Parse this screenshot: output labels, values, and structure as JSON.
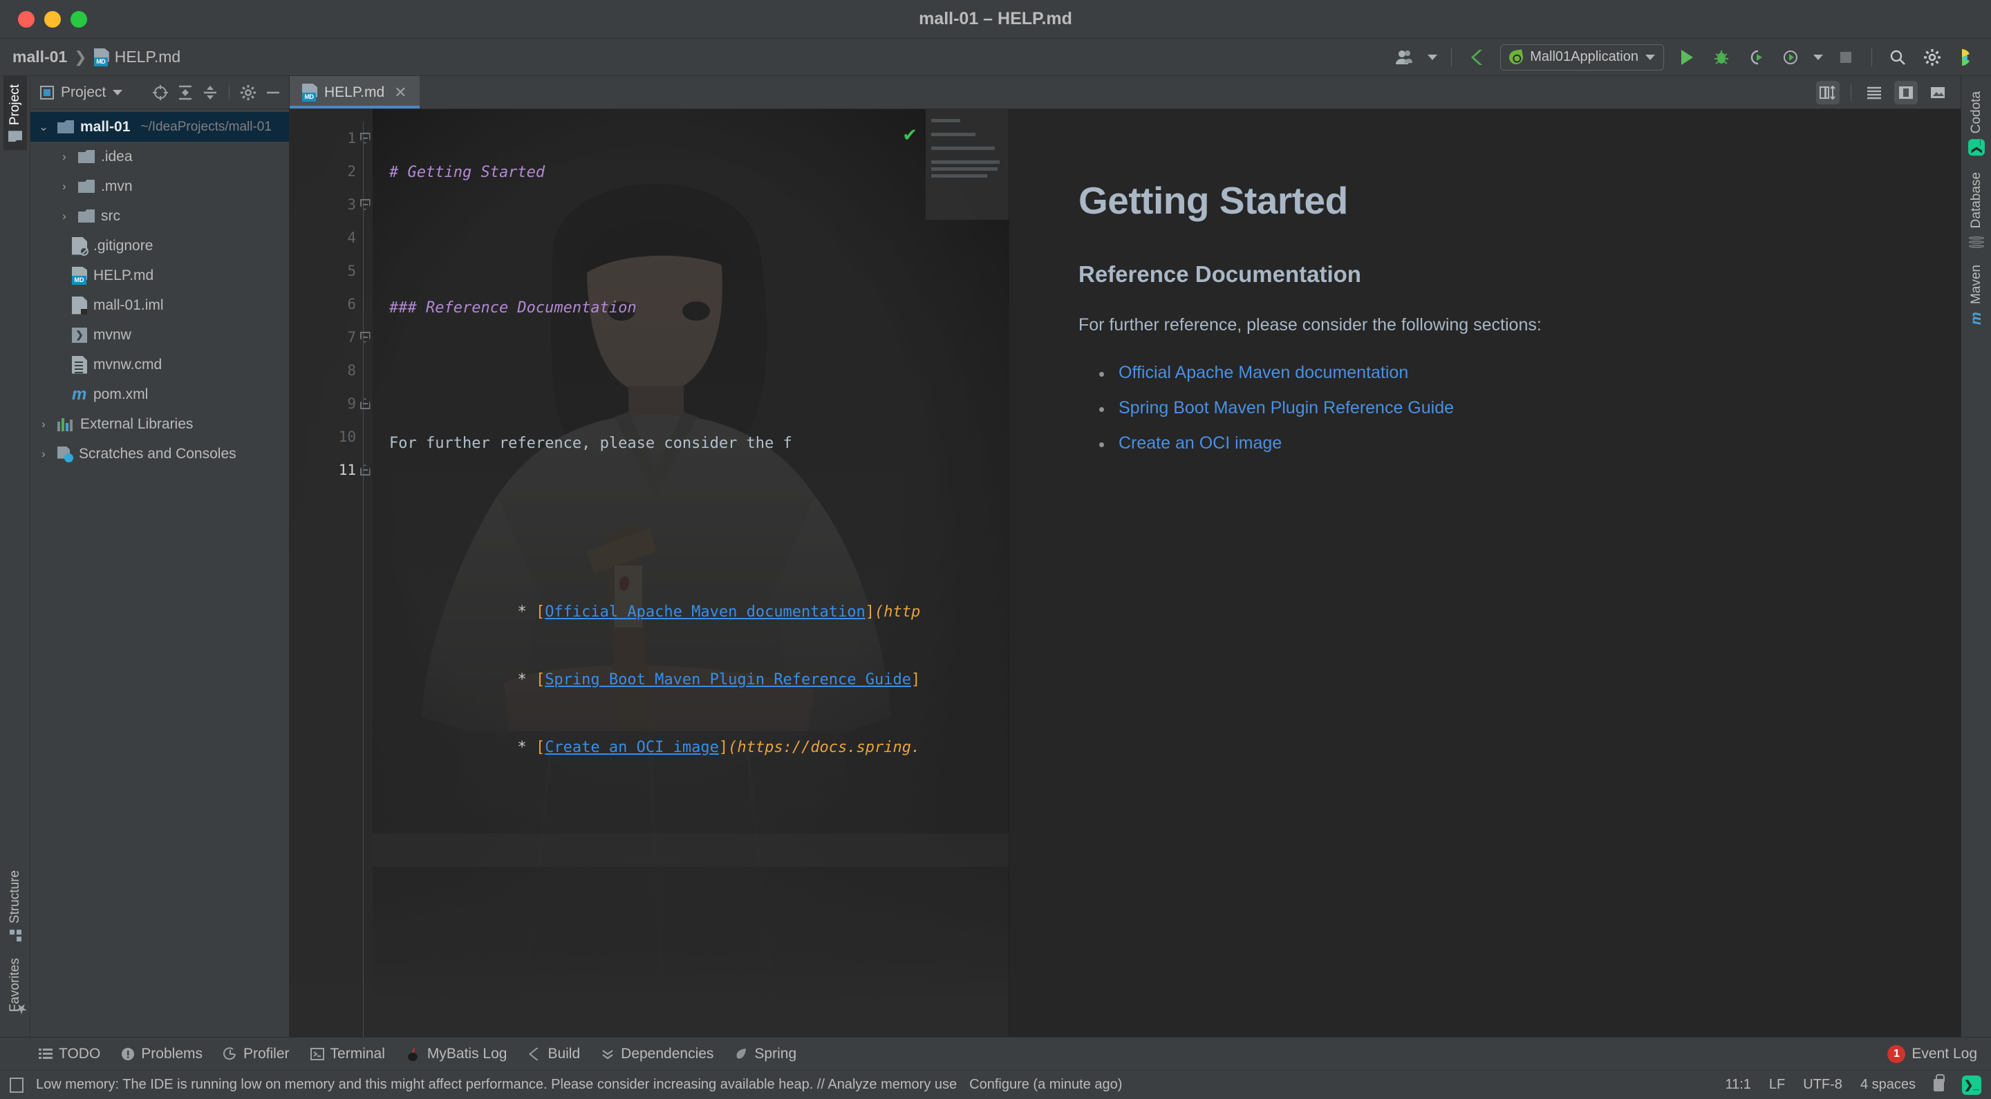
{
  "window": {
    "title": "mall-01 – HELP.md",
    "controls": [
      "close",
      "minimize",
      "maximize"
    ]
  },
  "navbar": {
    "breadcrumb": [
      {
        "label": "mall-01",
        "icon": ""
      },
      {
        "label": "HELP.md",
        "icon": "markdown-file-icon"
      }
    ],
    "separator": "❯",
    "run_config": {
      "label": "Mall01Application",
      "icon": "spring-leaf-icon",
      "caret": "▾"
    },
    "icons": [
      {
        "name": "user-accounts-icon",
        "glyph": "👥"
      },
      {
        "name": "vcs-update-icon",
        "glyph": "✓"
      },
      {
        "name": "run-icon",
        "glyph": "▶"
      },
      {
        "name": "debug-icon",
        "glyph": "🐞"
      },
      {
        "name": "run-with-coverage-icon",
        "glyph": "↻"
      },
      {
        "name": "profiler-icon",
        "glyph": "⏱"
      },
      {
        "name": "stop-icon",
        "glyph": "■"
      },
      {
        "name": "search-everywhere-icon",
        "glyph": "🔍"
      },
      {
        "name": "settings-gear-icon",
        "glyph": "⚙"
      },
      {
        "name": "ide-features-icon",
        "glyph": "◑"
      }
    ]
  },
  "left_strip": {
    "top": [
      {
        "label": "Project",
        "active": true
      }
    ],
    "bottom": [
      {
        "label": "Structure",
        "active": false
      },
      {
        "label": "Favorites",
        "active": false
      }
    ]
  },
  "project_panel": {
    "title": "Project",
    "title_caret": "▾",
    "tools": [
      {
        "name": "select-opened-file-icon",
        "glyph": "⊕"
      },
      {
        "name": "expand-all-icon",
        "glyph": "⬍"
      },
      {
        "name": "collapse-all-icon",
        "glyph": "⬌"
      },
      {
        "name": "panel-settings-icon",
        "glyph": "⚙"
      },
      {
        "name": "hide-panel-icon",
        "glyph": "—"
      }
    ],
    "tree": [
      {
        "label": "mall-01",
        "path": "~/IdeaProjects/mall-01",
        "icon": "project-folder-icon",
        "chevron": "⌄",
        "level": 0,
        "selected": true,
        "bold": true
      },
      {
        "label": ".idea",
        "icon": "folder-icon",
        "chevron": "›",
        "level": 1
      },
      {
        "label": ".mvn",
        "icon": "folder-icon",
        "chevron": "›",
        "level": 1
      },
      {
        "label": "src",
        "icon": "folder-icon",
        "chevron": "›",
        "level": 1
      },
      {
        "label": ".gitignore",
        "icon": "gitignore-file-icon",
        "level": 2
      },
      {
        "label": "HELP.md",
        "icon": "markdown-file-icon",
        "level": 2
      },
      {
        "label": "mall-01.iml",
        "icon": "iml-file-icon",
        "level": 2
      },
      {
        "label": "mvnw",
        "icon": "shell-script-icon",
        "level": 2
      },
      {
        "label": "mvnw.cmd",
        "icon": "cmd-script-icon",
        "level": 2
      },
      {
        "label": "pom.xml",
        "icon": "maven-pom-icon",
        "level": 2
      },
      {
        "label": "External Libraries",
        "icon": "external-libraries-icon",
        "chevron": "›",
        "level": 0
      },
      {
        "label": "Scratches and Consoles",
        "icon": "scratches-icon",
        "chevron": "›",
        "level": 0
      }
    ]
  },
  "editor": {
    "tab": {
      "label": "HELP.md",
      "icon": "markdown-file-icon",
      "close": "✕",
      "active": true
    },
    "preview_tools": [
      {
        "name": "split-sync-scroll-icon",
        "glyph": "↕",
        "on": true
      },
      {
        "name": "show-editor-only-icon",
        "glyph": "☰",
        "on": false
      },
      {
        "name": "show-editor-and-preview-icon",
        "glyph": "▣",
        "on": true
      },
      {
        "name": "show-preview-only-icon",
        "glyph": "🖼",
        "on": false
      }
    ],
    "inspection_status": "✔",
    "line_numbers": [
      "1",
      "2",
      "3",
      "4",
      "5",
      "6",
      "7",
      "8",
      "9",
      "10",
      "11"
    ],
    "current_line": 11,
    "lines": [
      {
        "n": 1,
        "fold": "down",
        "tokens": [
          {
            "t": "# Getting Started",
            "c": "hdr"
          }
        ]
      },
      {
        "n": 2,
        "tokens": []
      },
      {
        "n": 3,
        "fold": "down",
        "tokens": [
          {
            "t": "### Reference Documentation",
            "c": "hdr"
          }
        ]
      },
      {
        "n": 4,
        "tokens": []
      },
      {
        "n": 5,
        "tokens": [
          {
            "t": "For further reference, please consider the f",
            "c": "txt"
          }
        ]
      },
      {
        "n": 6,
        "tokens": []
      },
      {
        "n": 7,
        "fold": "down",
        "tokens": [
          {
            "t": "* ",
            "c": "bullet"
          },
          {
            "t": "[",
            "c": "lbrack"
          },
          {
            "t": "Official Apache Maven documentation",
            "c": "lnk"
          },
          {
            "t": "]",
            "c": "lbrack"
          },
          {
            "t": "(http",
            "c": "url"
          }
        ]
      },
      {
        "n": 8,
        "tokens": [
          {
            "t": "* ",
            "c": "bullet"
          },
          {
            "t": "[",
            "c": "lbrack"
          },
          {
            "t": "Spring Boot Maven Plugin Reference Guide",
            "c": "lnk"
          },
          {
            "t": "]",
            "c": "lbrack"
          }
        ]
      },
      {
        "n": 9,
        "fold": "up",
        "tokens": [
          {
            "t": "* ",
            "c": "bullet"
          },
          {
            "t": "[",
            "c": "lbrack"
          },
          {
            "t": "Create an OCI image",
            "c": "lnk"
          },
          {
            "t": "]",
            "c": "lbrack"
          },
          {
            "t": "(https://docs.spring.",
            "c": "url"
          }
        ]
      },
      {
        "n": 10,
        "tokens": []
      },
      {
        "n": 11,
        "fold": "up",
        "tokens": []
      }
    ]
  },
  "preview": {
    "h1": "Getting Started",
    "h2": "Reference Documentation",
    "paragraph": "For further reference, please consider the following sections:",
    "links": [
      "Official Apache Maven documentation",
      "Spring Boot Maven Plugin Reference Guide",
      "Create an OCI image"
    ]
  },
  "right_strip": [
    {
      "label": "Codota",
      "icon": "codota-icon"
    },
    {
      "label": "Database",
      "icon": "database-icon"
    },
    {
      "label": "Maven",
      "icon": "maven-icon"
    }
  ],
  "bottom_bar": {
    "tabs": [
      {
        "label": "TODO",
        "icon": "todo-list-icon",
        "glyph": "☰"
      },
      {
        "label": "Problems",
        "icon": "problems-icon",
        "glyph": "ⓘ"
      },
      {
        "label": "Profiler",
        "icon": "profiler-icon",
        "glyph": "◴"
      },
      {
        "label": "Terminal",
        "icon": "terminal-icon",
        "glyph": "▸"
      },
      {
        "label": "MyBatis Log",
        "icon": "mybatis-log-icon",
        "glyph": "🐦"
      },
      {
        "label": "Build",
        "icon": "build-hammer-icon",
        "glyph": "⚒"
      },
      {
        "label": "Dependencies",
        "icon": "dependencies-icon",
        "glyph": "⇊"
      },
      {
        "label": "Spring",
        "icon": "spring-leaf-icon",
        "glyph": "❧"
      }
    ],
    "event_log": {
      "label": "Event Log",
      "count": "1"
    }
  },
  "status_bar": {
    "message": "Low memory: The IDE is running low on memory and this might affect performance. Please consider increasing available heap. // Analyze memory use",
    "configure": "Configure (a minute ago)",
    "caret_position": "11:1",
    "line_separator": "LF",
    "encoding": "UTF-8",
    "indent": "4 spaces",
    "lock_icon": "read-write-lock-icon",
    "terminal_icon": "codota-terminal-icon"
  },
  "colors": {
    "accent_blue": "#4a88c7",
    "link_blue": "#3a8ee6",
    "header_purple": "#b389d6",
    "url_orange": "#e8a33d",
    "green": "#6cb33f",
    "badge_red": "#d0342c",
    "codota_green": "#16c98d",
    "panel_bg": "#3c3f41",
    "editor_bg": "#2b2b2b",
    "preview_bg": "#262626",
    "selection_bg": "#0d293e"
  }
}
